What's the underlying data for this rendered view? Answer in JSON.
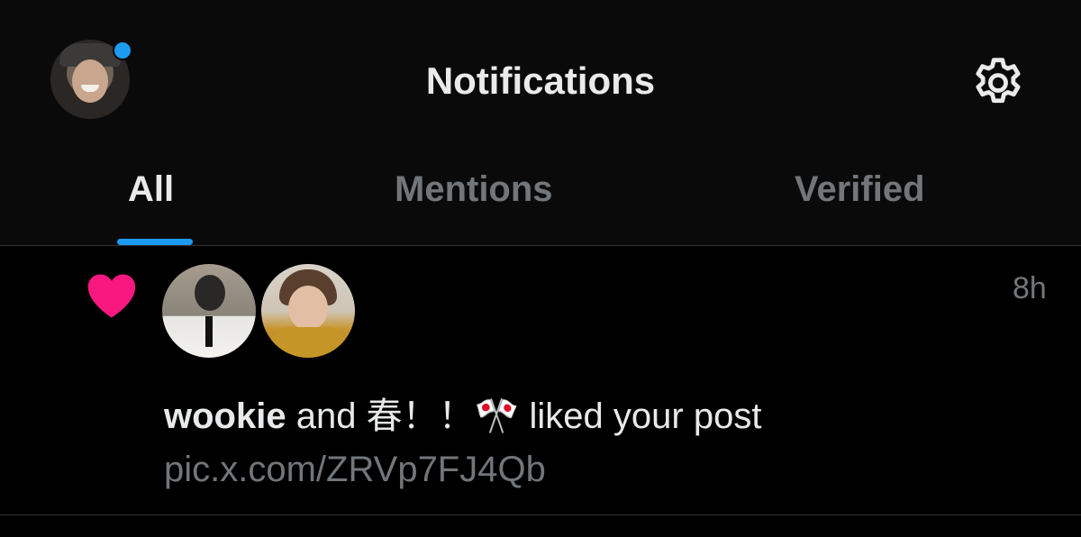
{
  "header": {
    "title": "Notifications",
    "unread_dot_color": "#1d9bf0",
    "settings_icon": "gear-icon"
  },
  "tabs": [
    {
      "label": "All",
      "active": true
    },
    {
      "label": "Mentions",
      "active": false
    },
    {
      "label": "Verified",
      "active": false
    }
  ],
  "notification": {
    "icon": "heart-icon",
    "icon_color": "#f91880",
    "time": "8h",
    "user1": "wookie",
    "connector": "and",
    "user2": "春！！🎌",
    "action": "liked your post",
    "link": "pic.x.com/ZRVp7FJ4Qb"
  }
}
